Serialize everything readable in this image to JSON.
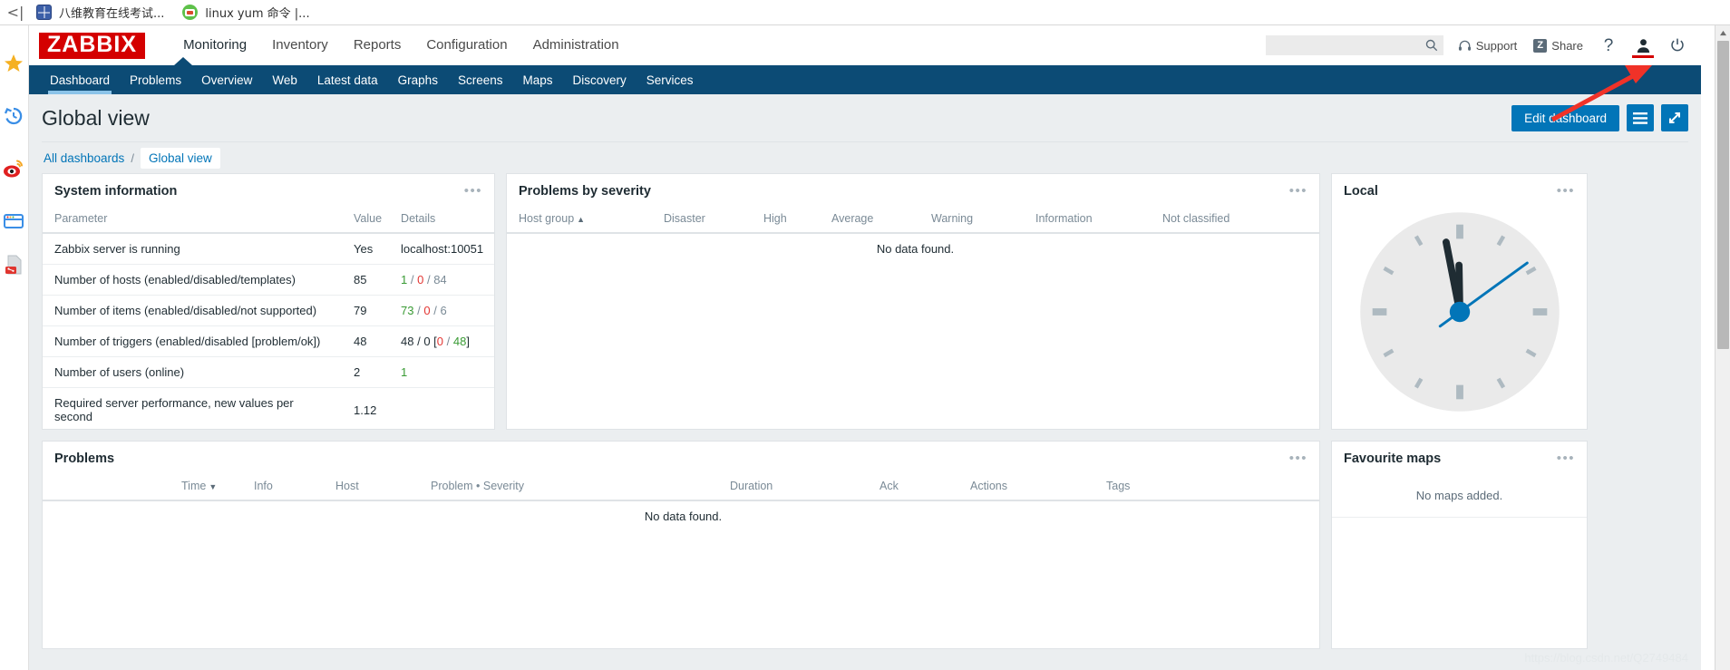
{
  "browser": {
    "back_label": "<|",
    "tabs": [
      {
        "title": "八维教育在线考试...",
        "icon": "globe-icon"
      },
      {
        "title": "linux yum 命令 |...",
        "icon": "code-circle-icon"
      }
    ]
  },
  "desktop_sidebar": {
    "items": [
      {
        "name": "favorites-star-icon",
        "label": "Favorites"
      },
      {
        "name": "history-clock-icon",
        "label": "History"
      },
      {
        "name": "weibo-icon",
        "label": "Weibo"
      },
      {
        "name": "window-icon",
        "label": "Window"
      },
      {
        "name": "pdf-share-icon",
        "label": "PDF"
      }
    ]
  },
  "header": {
    "logo": "ZABBIX",
    "nav": [
      {
        "label": "Monitoring",
        "selected": true
      },
      {
        "label": "Inventory",
        "selected": false
      },
      {
        "label": "Reports",
        "selected": false
      },
      {
        "label": "Configuration",
        "selected": false
      },
      {
        "label": "Administration",
        "selected": false
      }
    ],
    "search": {
      "value": "",
      "placeholder": ""
    },
    "support_label": "Support",
    "share_label": "Share",
    "share_badge": "Z",
    "help_label": "?"
  },
  "subnav": {
    "items": [
      {
        "label": "Dashboard",
        "selected": true
      },
      {
        "label": "Problems",
        "selected": false
      },
      {
        "label": "Overview",
        "selected": false
      },
      {
        "label": "Web",
        "selected": false
      },
      {
        "label": "Latest data",
        "selected": false
      },
      {
        "label": "Graphs",
        "selected": false
      },
      {
        "label": "Screens",
        "selected": false
      },
      {
        "label": "Maps",
        "selected": false
      },
      {
        "label": "Discovery",
        "selected": false
      },
      {
        "label": "Services",
        "selected": false
      }
    ]
  },
  "page": {
    "title": "Global view",
    "edit_dashboard_label": "Edit dashboard",
    "breadcrumb": {
      "root": "All dashboards",
      "separator": "/",
      "current": "Global view"
    }
  },
  "widgets": {
    "system_information": {
      "title": "System information",
      "columns": [
        "Parameter",
        "Value",
        "Details"
      ],
      "rows": [
        {
          "parameter": "Zabbix server is running",
          "value": "Yes",
          "value_color": "green",
          "details": [
            {
              "text": "localhost:10051",
              "color": "default"
            }
          ]
        },
        {
          "parameter": "Number of hosts (enabled/disabled/templates)",
          "value": "85",
          "value_color": "default",
          "details": [
            {
              "text": "1",
              "color": "green"
            },
            {
              "text": " / ",
              "color": "gray"
            },
            {
              "text": "0",
              "color": "red"
            },
            {
              "text": " / ",
              "color": "gray"
            },
            {
              "text": "84",
              "color": "gray"
            }
          ]
        },
        {
          "parameter": "Number of items (enabled/disabled/not supported)",
          "value": "79",
          "value_color": "default",
          "details": [
            {
              "text": "73",
              "color": "green"
            },
            {
              "text": " / ",
              "color": "gray"
            },
            {
              "text": "0",
              "color": "red"
            },
            {
              "text": " / ",
              "color": "gray"
            },
            {
              "text": "6",
              "color": "gray"
            }
          ]
        },
        {
          "parameter": "Number of triggers (enabled/disabled [problem/ok])",
          "value": "48",
          "value_color": "default",
          "details": [
            {
              "text": "48 / 0 [",
              "color": "default"
            },
            {
              "text": "0",
              "color": "red"
            },
            {
              "text": " / ",
              "color": "gray"
            },
            {
              "text": "48",
              "color": "green"
            },
            {
              "text": "]",
              "color": "default"
            }
          ]
        },
        {
          "parameter": "Number of users (online)",
          "value": "2",
          "value_color": "default",
          "details": [
            {
              "text": "1",
              "color": "green"
            }
          ]
        },
        {
          "parameter": "Required server performance, new values per second",
          "value": "1.12",
          "value_color": "default",
          "details": []
        }
      ]
    },
    "problems_by_severity": {
      "title": "Problems by severity",
      "columns": [
        "Host group",
        "Disaster",
        "High",
        "Average",
        "Warning",
        "Information",
        "Not classified"
      ],
      "sort_column": "Host group",
      "sort_direction": "asc",
      "sort_glyph": "▲",
      "empty_text": "No data found."
    },
    "local_clock": {
      "title": "Local",
      "time": {
        "hour": 11,
        "minute": 58,
        "second": 9
      },
      "face_color": "#eaeaea",
      "hand_color": "#1f2c33",
      "second_hand_color": "#0275b8"
    },
    "problems": {
      "title": "Problems",
      "columns": [
        "Time",
        "Info",
        "Host",
        "Problem • Severity",
        "Duration",
        "Ack",
        "Actions",
        "Tags"
      ],
      "sort_column": "Time",
      "sort_direction": "desc",
      "sort_glyph": "▼",
      "empty_text": "No data found."
    },
    "favourite_maps": {
      "title": "Favourite maps",
      "empty_text": "No maps added."
    }
  },
  "watermark": "https://blog.csdn.net/Q2749484",
  "colors": {
    "brand_red": "#d40000",
    "header_blue": "#0c4b75",
    "accent_blue": "#0275b8",
    "annotation_red": "#f03228",
    "page_bg": "#ebeef0"
  }
}
